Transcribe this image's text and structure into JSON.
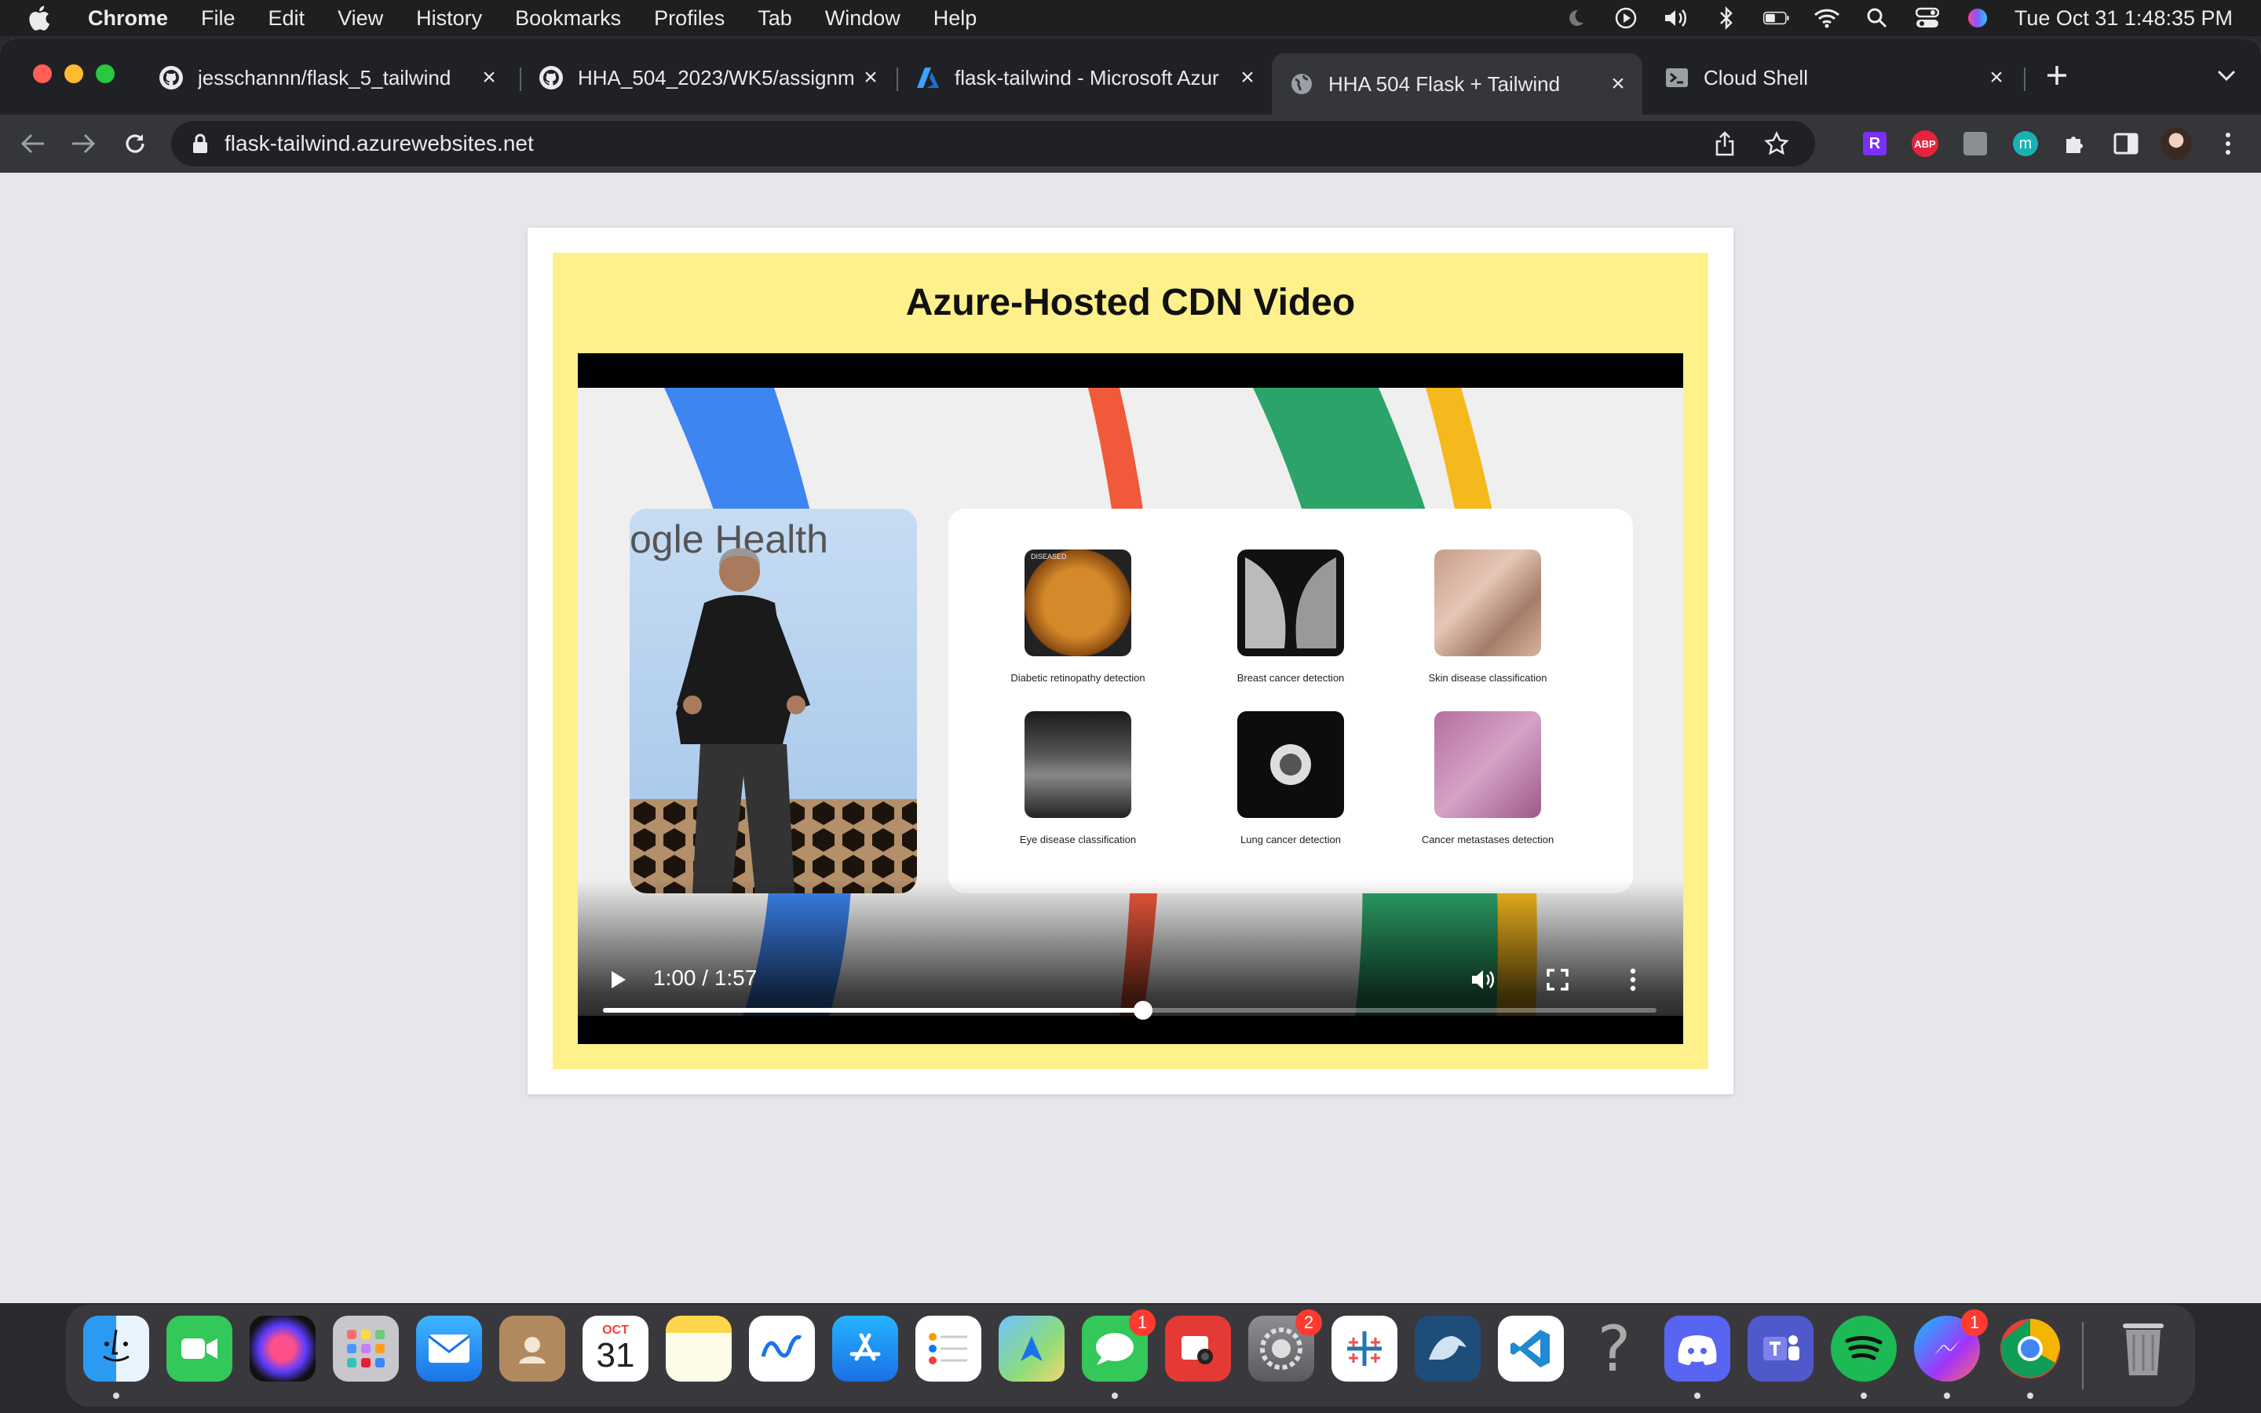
{
  "menubar": {
    "app_name": "Chrome",
    "items": [
      "File",
      "Edit",
      "View",
      "History",
      "Bookmarks",
      "Profiles",
      "Tab",
      "Window",
      "Help"
    ],
    "clock": "Tue Oct 31  1:48:35 PM"
  },
  "tabs": [
    {
      "title": "jesschannn/flask_5_tailwind",
      "icon": "github-icon"
    },
    {
      "title": "HHA_504_2023/WK5/assignm",
      "icon": "github-icon"
    },
    {
      "title": "flask-tailwind - Microsoft Azur",
      "icon": "azure-icon"
    },
    {
      "title": "HHA 504 Flask + Tailwind",
      "icon": "globe-icon",
      "active": true
    },
    {
      "title": "Cloud Shell",
      "icon": "terminal-icon"
    }
  ],
  "toolbar": {
    "url": "flask-tailwind.azurewebsites.net",
    "extensions": [
      "R",
      "ABP",
      "m"
    ]
  },
  "page": {
    "heading": "Azure-Hosted CDN Video",
    "background_color": "#e5e7eb",
    "panel_color": "#fef08a"
  },
  "video": {
    "brand_text": "ogle Health",
    "tiles": [
      {
        "caption": "Diabetic retinopathy detection",
        "label": "DISEASED"
      },
      {
        "caption": "Breast cancer detection"
      },
      {
        "caption": "Skin disease classification"
      },
      {
        "caption": "Eye disease classification"
      },
      {
        "caption": "Lung cancer detection"
      },
      {
        "caption": "Cancer metastases detection"
      }
    ],
    "time_display": "1:00 / 1:57",
    "progress": 0.513
  },
  "dock": {
    "calendar_month": "OCT",
    "calendar_day": "31",
    "badges": {
      "messages": "1",
      "sysprefs": "2",
      "messenger": "1"
    }
  }
}
